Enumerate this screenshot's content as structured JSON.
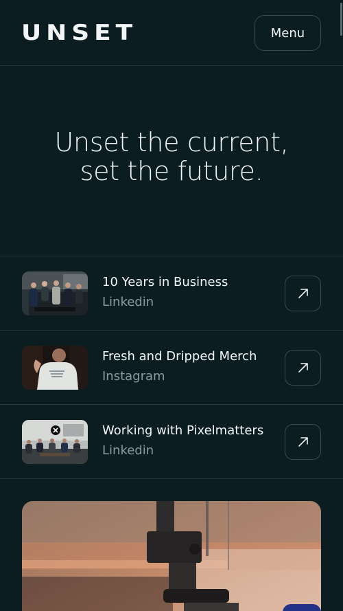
{
  "header": {
    "logo": "UNSET",
    "menu_label": "Menu"
  },
  "hero": {
    "line1": "Unset the current,",
    "line2": "set the future."
  },
  "posts": [
    {
      "title": "10 Years in Business",
      "source": "Linkedin",
      "thumb": "team-photo",
      "icon": "arrow-up-right-icon"
    },
    {
      "title": "Fresh and Dripped Merch",
      "source": "Instagram",
      "thumb": "merch-photo",
      "icon": "arrow-up-right-icon"
    },
    {
      "title": "Working with Pixelmatters",
      "source": "Linkedin",
      "thumb": "meeting-photo",
      "icon": "arrow-up-right-icon"
    }
  ],
  "colors": {
    "background": "#0b1d21",
    "border": "#243639",
    "text": "#f3f6f7",
    "muted": "#8d9a9d"
  }
}
